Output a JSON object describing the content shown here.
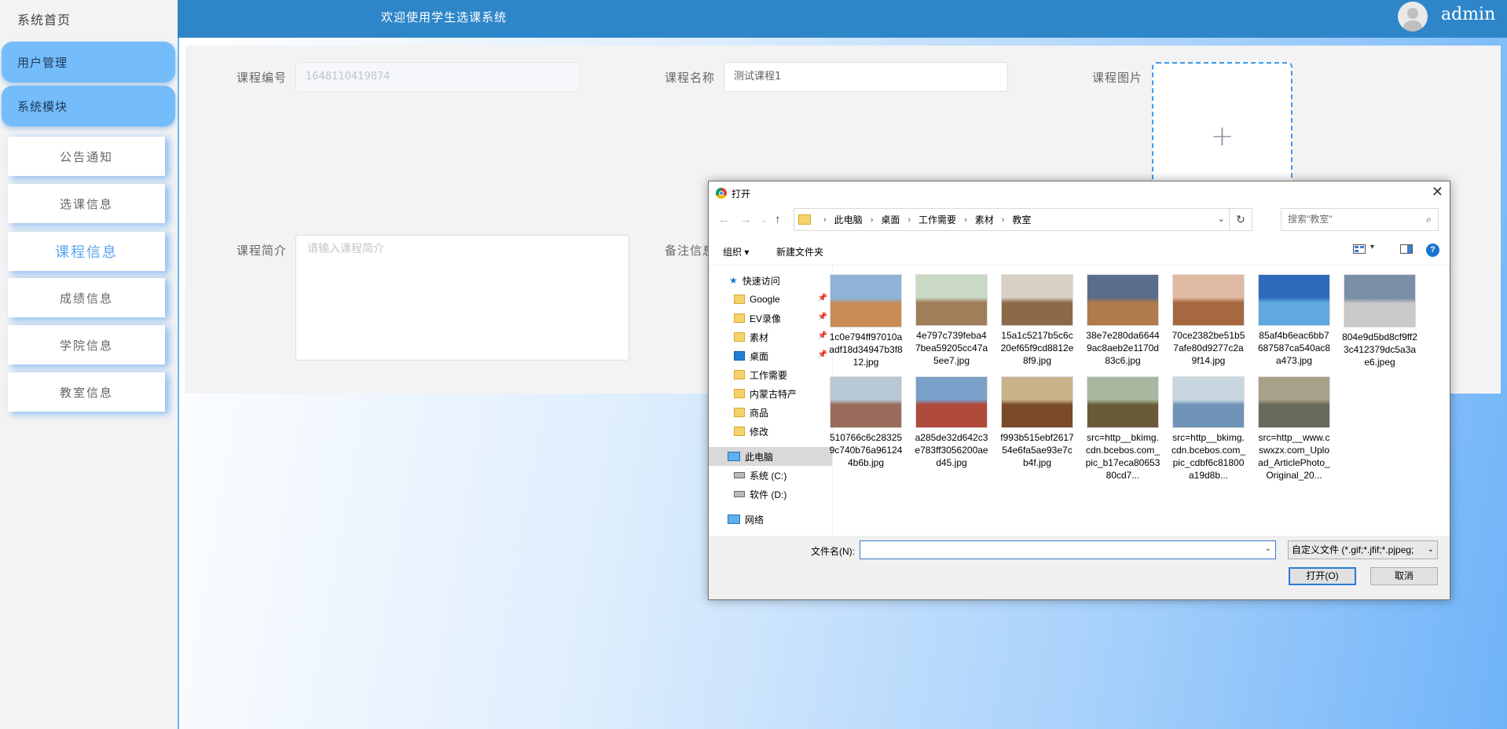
{
  "sidebar": {
    "home": "系统首页",
    "groups": [
      "用户管理",
      "系统模块"
    ],
    "items": [
      "公告通知",
      "选课信息",
      "课程信息",
      "成绩信息",
      "学院信息",
      "教室信息"
    ]
  },
  "header": {
    "welcome": "欢迎使用学生选课系统",
    "user": "admin"
  },
  "form": {
    "course_no_label": "课程编号",
    "course_no_value": "1648110419874",
    "course_name_label": "课程名称",
    "course_name_value": "测试课程1",
    "course_img_label": "课程图片",
    "intro_label": "课程简介",
    "intro_placeholder": "请输入课程简介",
    "remark_label": "备注信息"
  },
  "dialog": {
    "title": "打开",
    "breadcrumb": [
      "此电脑",
      "桌面",
      "工作需要",
      "素材",
      "教室"
    ],
    "search_placeholder": "搜索\"教室\"",
    "organize": "组织 ▾",
    "new_folder": "新建文件夹",
    "tree": {
      "quick_access": "快速访问",
      "pinned": [
        "Google",
        "EV录像",
        "素材",
        "桌面"
      ],
      "folders": [
        "工作需要",
        "内蒙古特产",
        "商品",
        "修改"
      ],
      "this_pc": "此电脑",
      "drives": [
        "系统 (C:)",
        "软件 (D:)"
      ],
      "network": "网络"
    },
    "files": [
      "1c0e794ff97010aadf18d34947b3f812.jpg",
      "4e797c739feba47bea59205cc47a5ee7.jpg",
      "15a1c5217b5c6c20ef65f9cd8812e8f9.jpg",
      "38e7e280da66449ac8aeb2e1170d83c6.jpg",
      "70ce2382be51b57afe80d9277c2a9f14.jpg",
      "85af4b6eac6bb7687587ca540ac8a473.jpg",
      "804e9d5bd8cf9ff23c412379dc5a3ae6.jpeg",
      "510766c6c283259c740b76a961244b6b.jpg",
      "a285de32d642c3e783ff3056200aed45.jpg",
      "f993b515ebf261754e6fa5ae93e7cb4f.jpg",
      "src=http__bkimg.cdn.bcebos.com_pic_b17eca8065380cd7...",
      "src=http__bkimg.cdn.bcebos.com_pic_cdbf6c81800a19d8b...",
      "src=http__www.cswxzx.com_Upload_ArticlePhoto_Original_20..."
    ],
    "filename_label": "文件名(N):",
    "filename_value": "",
    "filetype": "自定义文件 (*.gif;*.jfif;*.pjpeg;",
    "open_btn": "打开(O)",
    "cancel_btn": "取消"
  },
  "colors": {
    "header": "#2e86c9",
    "accent": "#74bcfa",
    "active_text": "#5aa5f0"
  }
}
